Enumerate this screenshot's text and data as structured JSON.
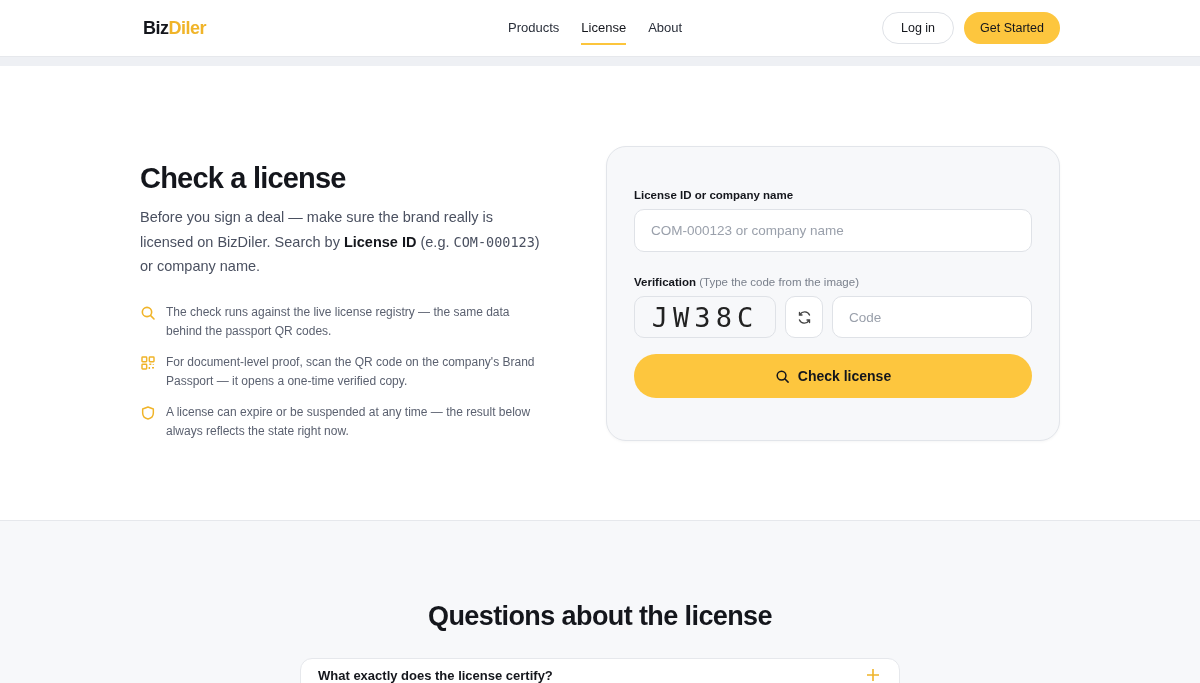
{
  "header": {
    "logo": {
      "part_1": "Biz",
      "part_2": "Diler"
    },
    "nav": [
      {
        "label": "Products",
        "selected": false
      },
      {
        "label": "License",
        "selected": true
      },
      {
        "label": "About",
        "selected": false
      }
    ],
    "login": "Log in",
    "cta": "Get Started"
  },
  "intro": {
    "title": "Check a license",
    "description": [
      {
        "kind": "text",
        "text": "Before you sign a deal — make sure the brand really is licensed on BizDiler. Search by "
      },
      {
        "kind": "strong",
        "text": "License ID"
      },
      {
        "kind": "text",
        "text": " (e.g. "
      },
      {
        "kind": "code",
        "text": "COM-000123"
      },
      {
        "kind": "text",
        "text": ") or company name."
      }
    ],
    "points": [
      {
        "kind": "search",
        "text": "The check runs against the live license registry — the same data behind the passport QR codes."
      },
      {
        "kind": "qr",
        "text": "For document-level proof, scan the QR code on the company's Brand Passport — it opens a one-time verified copy."
      },
      {
        "kind": "shield",
        "text": "A license can expire or be suspended at any time — the result below always reflects the state right now."
      }
    ]
  },
  "form": {
    "id_label": "License ID or company name",
    "id_placeholder": "COM-000123 or company name",
    "verification_label": "Verification",
    "verification_hint": "(Type the code from the image)",
    "captcha": "JW38C",
    "code_placeholder": "Code",
    "submit": "Check license"
  },
  "faq": {
    "title": "Questions about the license",
    "items": [
      {
        "question": "What exactly does the license certify?"
      }
    ]
  }
}
